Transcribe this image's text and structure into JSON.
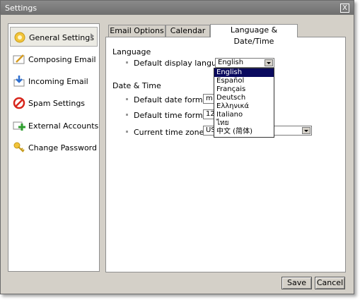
{
  "window": {
    "title": "Settings",
    "close_label": "X"
  },
  "sidebar": {
    "items": [
      {
        "label": "General Settings",
        "icon": "gear-icon",
        "selected": true
      },
      {
        "label": "Composing Email",
        "icon": "compose-icon"
      },
      {
        "label": "Incoming Email",
        "icon": "incoming-icon"
      },
      {
        "label": "Spam Settings",
        "icon": "spam-icon"
      },
      {
        "label": "External Accounts",
        "icon": "external-accounts-icon"
      },
      {
        "label": "Change Password",
        "icon": "key-icon"
      }
    ]
  },
  "tabs": [
    {
      "label": "Email Options"
    },
    {
      "label": "Calendar"
    },
    {
      "label": "Language & Date/Time",
      "active": true
    }
  ],
  "language": {
    "section_title": "Language",
    "display_language_label": "Default display language:",
    "display_language_value": "English",
    "options": [
      "English",
      "Español",
      "Français",
      "Deutsch",
      "Ελληνικά",
      "Italiano",
      "ไทย",
      "中文 (简体)"
    ]
  },
  "datetime": {
    "section_title": "Date & Time",
    "date_format_label": "Default date format:",
    "date_format_value": "m",
    "time_format_label": "Default time format:",
    "time_format_value": "12",
    "timezone_label": "Current time zone:",
    "timezone_value": "US"
  },
  "footer": {
    "save_label": "Save",
    "cancel_label": "Cancel"
  },
  "colors": {
    "selection": "#0a0a5e",
    "titlebar": "#7a7a7a"
  }
}
